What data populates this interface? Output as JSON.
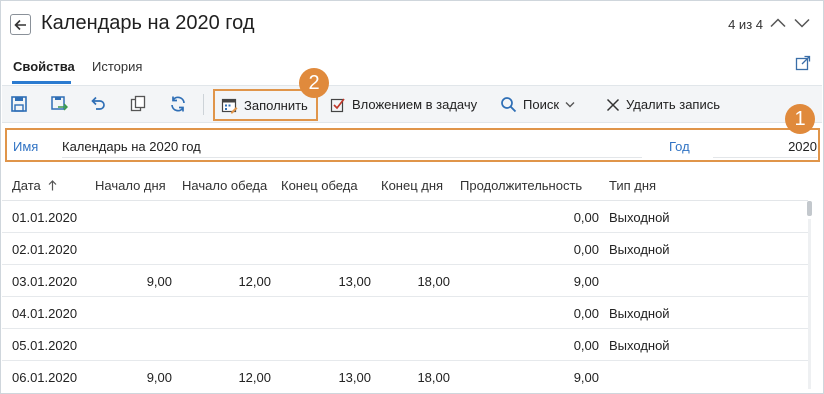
{
  "header": {
    "title": "Календарь на 2020 год",
    "pager": "4 из 4"
  },
  "tabs": [
    {
      "label": "Свойства",
      "active": true
    },
    {
      "label": "История",
      "active": false
    }
  ],
  "toolbar": {
    "icons": [
      "save-icon",
      "save-and-close-icon",
      "undo-icon",
      "copy-icon",
      "refresh-icon"
    ],
    "fill_label": "Заполнить",
    "attach_label": "Вложением в задачу",
    "search_label": "Поиск",
    "delete_label": "Удалить запись"
  },
  "fields": {
    "name_label": "Имя",
    "name_value": "Календарь на 2020 год",
    "year_label": "Год",
    "year_value": "2020"
  },
  "badges": {
    "one": "1",
    "two": "2"
  },
  "accent_color": "#e08a3c",
  "link_color": "#3073c4",
  "table": {
    "columns": [
      "Дата",
      "Начало дня",
      "Начало обеда",
      "Конец обеда",
      "Конец дня",
      "Продолжительность",
      "Тип дня"
    ],
    "rows": [
      {
        "date": "01.01.2020",
        "start": "",
        "lunch_start": "",
        "lunch_end": "",
        "end": "",
        "duration": "0,00",
        "type": "Выходной"
      },
      {
        "date": "02.01.2020",
        "start": "",
        "lunch_start": "",
        "lunch_end": "",
        "end": "",
        "duration": "0,00",
        "type": "Выходной"
      },
      {
        "date": "03.01.2020",
        "start": "9,00",
        "lunch_start": "12,00",
        "lunch_end": "13,00",
        "end": "18,00",
        "duration": "9,00",
        "type": ""
      },
      {
        "date": "04.01.2020",
        "start": "",
        "lunch_start": "",
        "lunch_end": "",
        "end": "",
        "duration": "0,00",
        "type": "Выходной"
      },
      {
        "date": "05.01.2020",
        "start": "",
        "lunch_start": "",
        "lunch_end": "",
        "end": "",
        "duration": "0,00",
        "type": "Выходной"
      },
      {
        "date": "06.01.2020",
        "start": "9,00",
        "lunch_start": "12,00",
        "lunch_end": "13,00",
        "end": "18,00",
        "duration": "9,00",
        "type": ""
      }
    ]
  }
}
